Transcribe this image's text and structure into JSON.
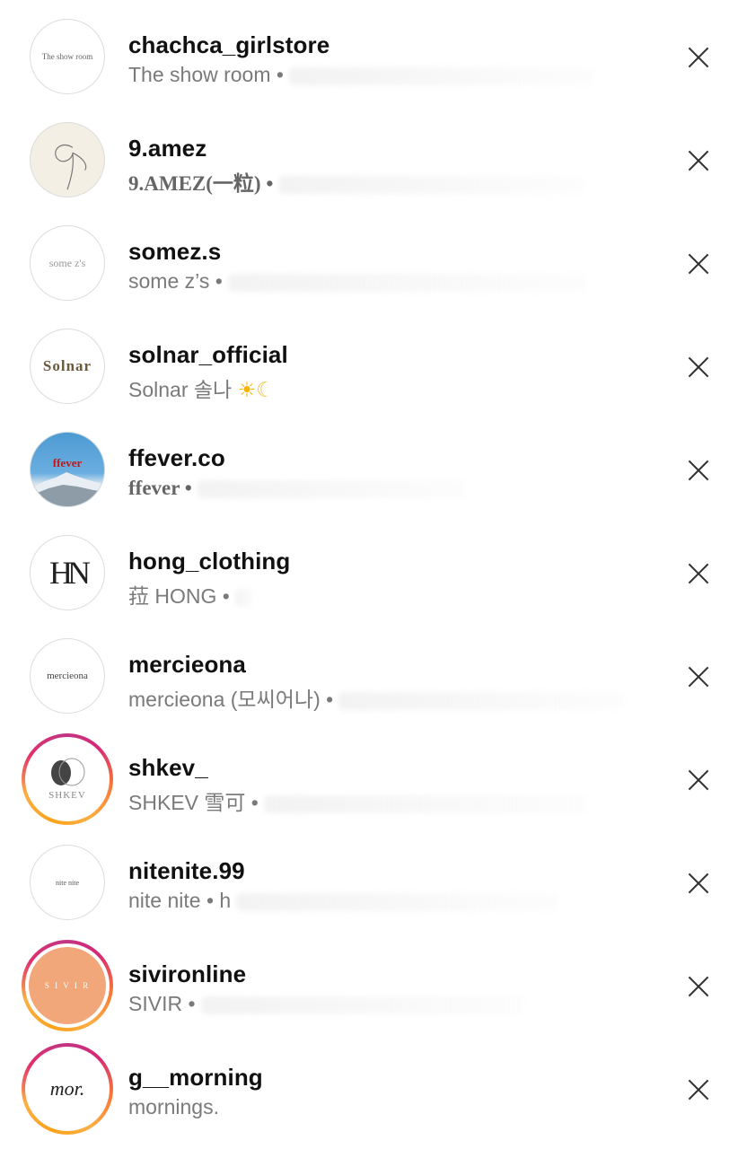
{
  "suggestions": [
    {
      "username": "chachca_girlstore",
      "subtitle": "The show room •",
      "avatar_text": "The show room"
    },
    {
      "username": "9.amez",
      "subtitle": "9.AMEZ(一粒) •",
      "avatar_text": "9"
    },
    {
      "username": "somez.s",
      "subtitle": "some z’s •",
      "avatar_text": "some z's"
    },
    {
      "username": "solnar_official",
      "subtitle": "Solnar 솔나",
      "avatar_text": "Solnar"
    },
    {
      "username": "ffever.co",
      "subtitle": "ffever •",
      "avatar_text": "ffever"
    },
    {
      "username": "hong_clothing",
      "subtitle": "菈 HONG •",
      "avatar_text": "HN"
    },
    {
      "username": "mercieona",
      "subtitle": "mercieona (모씨어나) •",
      "avatar_text": "mercieona"
    },
    {
      "username": "shkev_",
      "subtitle": "SHKEV 雪可 •",
      "avatar_text": "SHKEV"
    },
    {
      "username": "nitenite.99",
      "subtitle": "nite nite • h",
      "avatar_text": "nite nite"
    },
    {
      "username": "sivironline",
      "subtitle": "SIVIR •",
      "avatar_text": "S I V I R"
    },
    {
      "username": "g__morning",
      "subtitle": "mornings.",
      "avatar_text": "mor."
    }
  ],
  "icons": {
    "dismiss": "close-icon",
    "sun": "sun-emoji",
    "moon": "moon-emoji"
  },
  "colors": {
    "username": "#111111",
    "subtitle": "#7a7a7a",
    "story_ring_start": "#f9a21b",
    "story_ring_end": "#c13584",
    "ffever_sky": "#3d8fc9",
    "sivir_fill": "#f2a77a"
  }
}
